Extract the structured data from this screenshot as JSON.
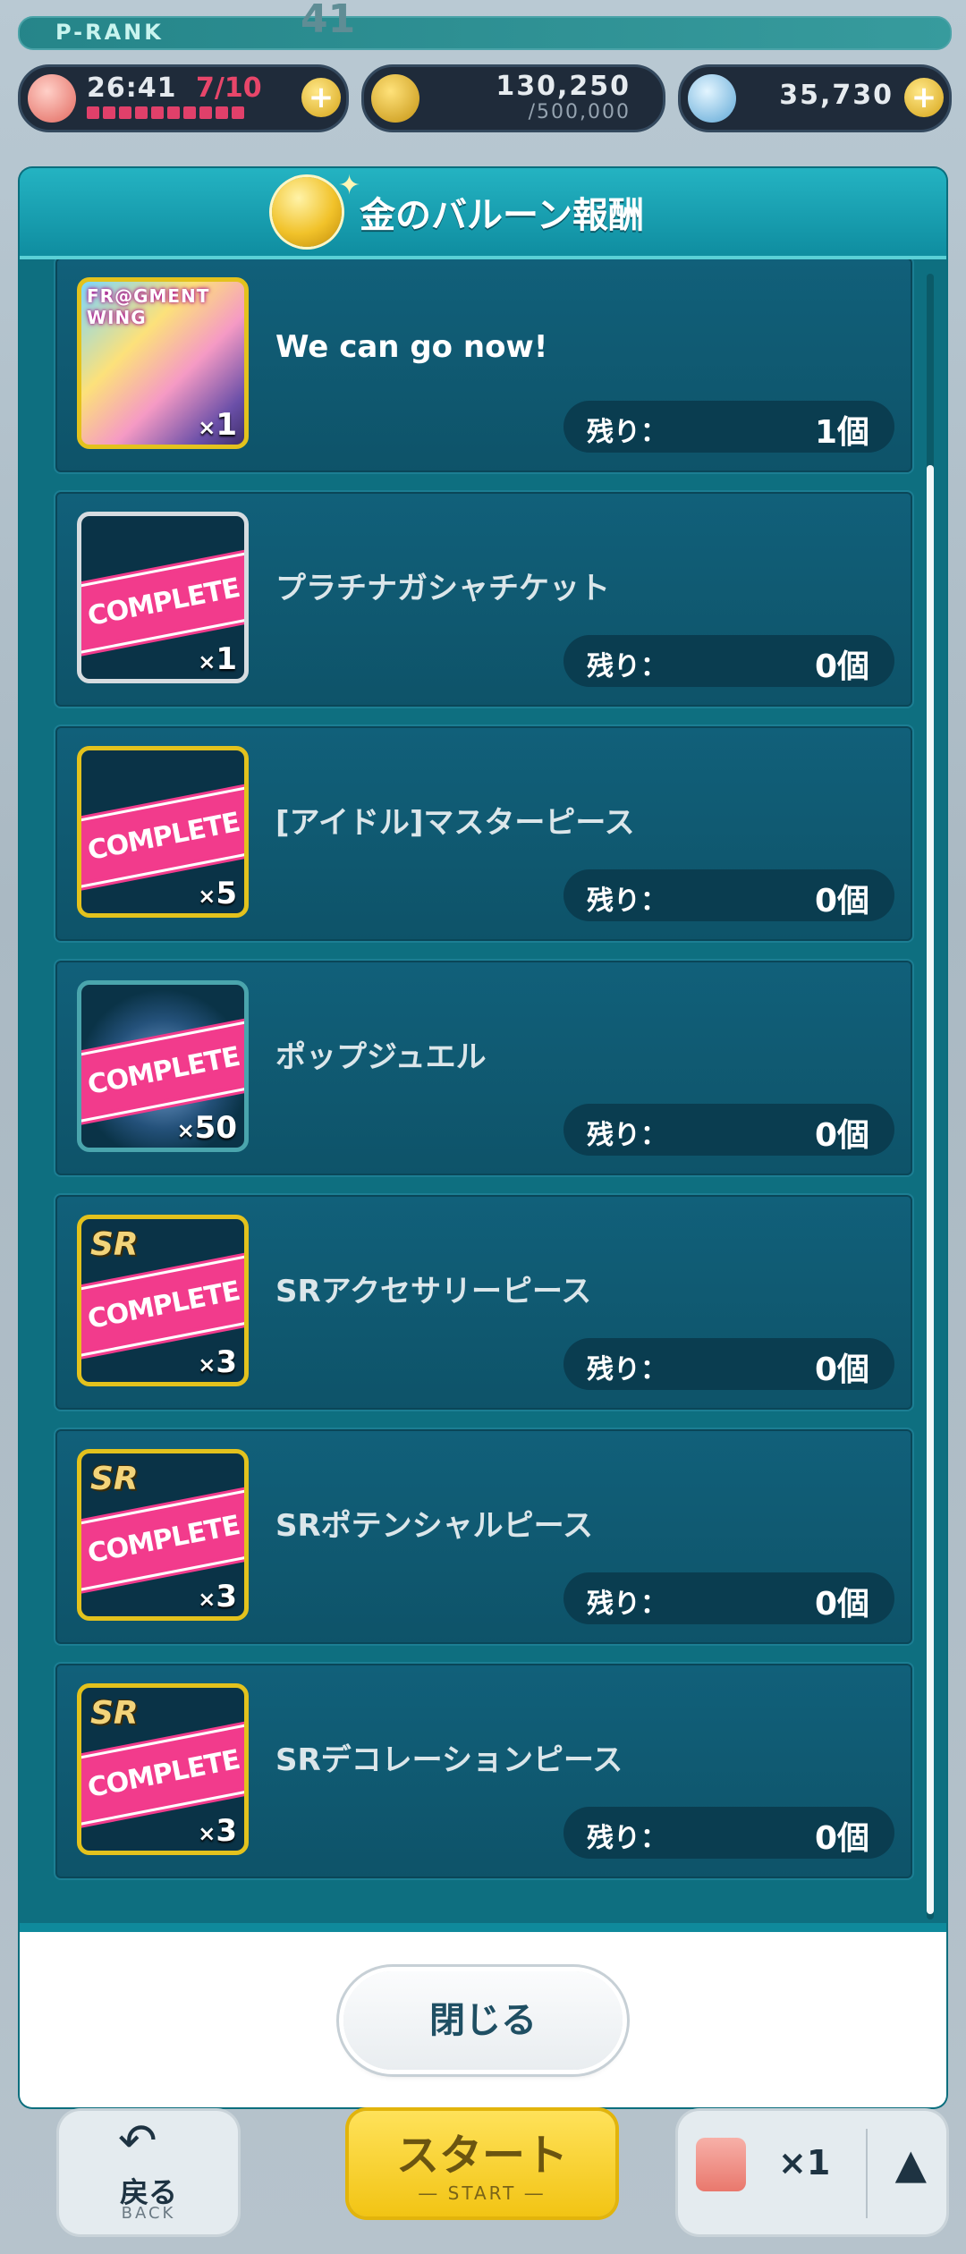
{
  "status": {
    "rank_label": "P-RANK",
    "rank_value": "41",
    "rank_progress": 1.0,
    "stamina_time": "26:41",
    "stamina_count": "7/10",
    "money_value": "130,250",
    "money_max": "/500,000",
    "jewel_value": "35,730",
    "plus": "+"
  },
  "modal": {
    "title": "金のバルーン報酬",
    "close_label": "閉じる",
    "remain_label": "残り：",
    "complete_label": "COMPLETE",
    "items": [
      {
        "name": "We can go now!",
        "qty": "1",
        "remain": "1個",
        "card_title": "FR@GMENT WING",
        "completed": false
      },
      {
        "name": "プラチナガシャチケット",
        "qty": "1",
        "remain": "0個",
        "completed": true
      },
      {
        "name": "[アイドル]マスターピース",
        "qty": "5",
        "remain": "0個",
        "completed": true
      },
      {
        "name": "ポップジュエル",
        "qty": "50",
        "remain": "0個",
        "completed": true
      },
      {
        "name": "SRアクセサリーピース",
        "qty": "3",
        "remain": "0個",
        "badge": "SR",
        "completed": true
      },
      {
        "name": "SRポテンシャルピース",
        "qty": "3",
        "remain": "0個",
        "badge": "SR",
        "completed": true
      },
      {
        "name": "SRデコレーションピース",
        "qty": "3",
        "remain": "0個",
        "badge": "SR",
        "completed": true
      }
    ]
  },
  "bottom": {
    "back_label": "戻る",
    "back_sub": "BACK",
    "start_label": "スタート",
    "start_sub": "― START ―",
    "item_count": "×1"
  },
  "icons": {
    "stamina": "stamina-bag-icon",
    "money": "coin-icon",
    "jewel": "jewel-icon",
    "medal": "gold-balloon-medal-icon"
  },
  "colors": {
    "modal_bg": "#0f8a9c",
    "complete_stamp": "#f23b8c",
    "gold_border": "#e3c21d"
  }
}
